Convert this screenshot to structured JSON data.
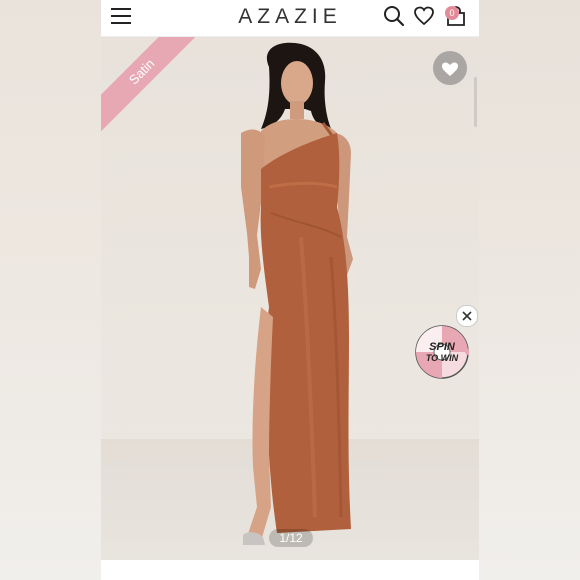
{
  "header": {
    "brand": "AZAZIE",
    "bag_count": "0"
  },
  "product": {
    "badge_label": "Satin",
    "image_counter": "1/12",
    "dress_color": "#b0603c"
  },
  "promo": {
    "line1": "SPIN",
    "line2": "TO WIN"
  },
  "colors": {
    "accent_pink": "#e8a8b3",
    "badge_pink": "#e38a98"
  }
}
